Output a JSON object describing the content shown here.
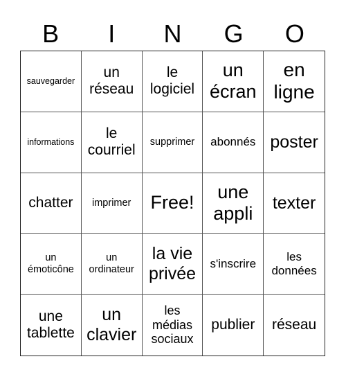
{
  "header": [
    "B",
    "I",
    "N",
    "G",
    "O"
  ],
  "cells": [
    "sauvegarder",
    "un réseau",
    "le logiciel",
    "un écran",
    "en ligne",
    "informations",
    "le courriel",
    "supprimer",
    "abonnés",
    "poster",
    "chatter",
    "imprimer",
    "Free!",
    "une appli",
    "texter",
    "un émoticône",
    "un ordinateur",
    "la vie privée",
    "s'inscrire",
    "les données",
    "une tablette",
    "un clavier",
    "les médias sociaux",
    "publier",
    "réseau"
  ]
}
